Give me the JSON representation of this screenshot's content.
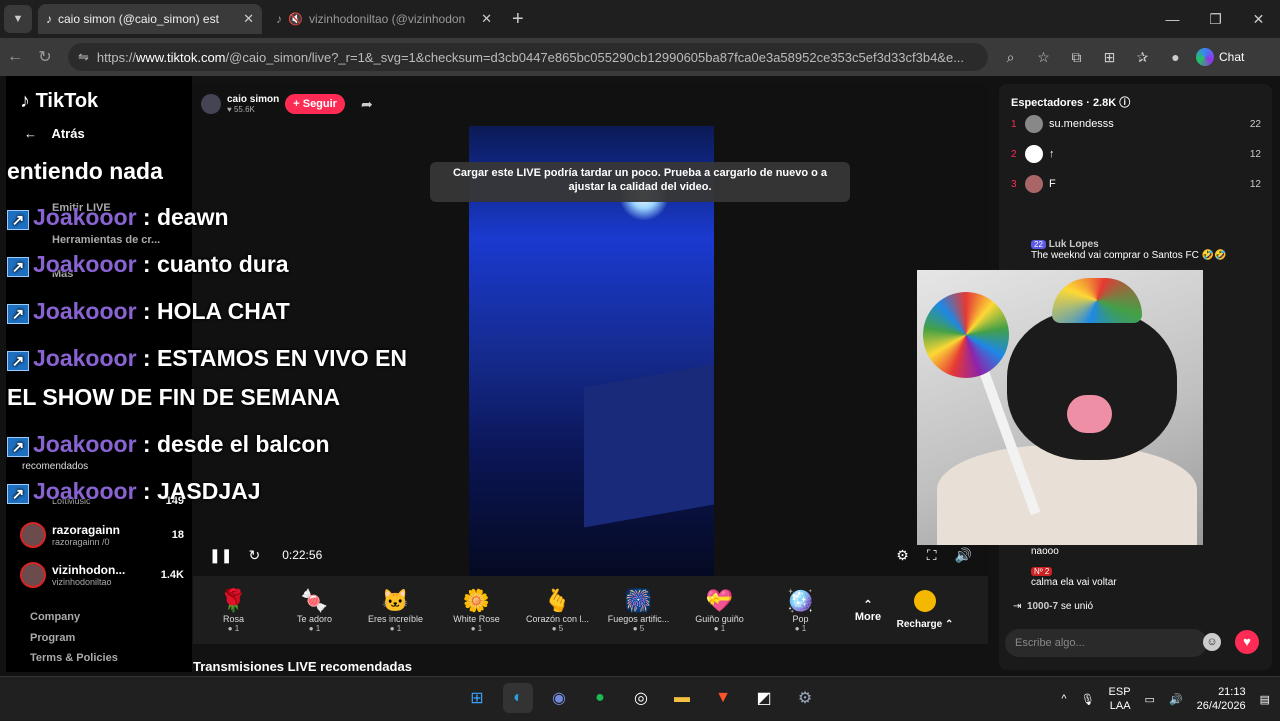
{
  "browser": {
    "tabs": [
      {
        "title": "caio simon (@caio_simon) est"
      },
      {
        "title": "vizinhodoniltao (@vizinhodon"
      }
    ],
    "url_prefix": "https://",
    "url_host": "www.tiktok.com",
    "url_rest": "/@caio_simon/live?_r=1&_svg=1&checksum=d3cb0447e865bc055290cb12990605ba87fca0e3a58952ce353c5ef3d33cf3b4&e...",
    "chat_label": "Chat"
  },
  "leftnav": {
    "logo": "TikTok",
    "back": "Atrás",
    "items": [
      "Emitir LIVE",
      "Herramientas de cr...",
      "Más"
    ],
    "recommended_heading": "recomendados",
    "recommended": [
      {
        "name": "razoragainn",
        "sub": "razoragainn /0",
        "count": "18"
      },
      {
        "name": "vizinhodon...",
        "sub": "vizinhodoniltao",
        "count": "1.4K"
      }
    ],
    "lofi_sub": "LoftMusic",
    "lofi_count": "149",
    "footer": [
      "Company",
      "Program",
      "Terms & Policies"
    ]
  },
  "stream": {
    "host_name": "caio simon",
    "host_followers": "55.6K",
    "follow_label": "+ Seguir",
    "loading_message": "Cargar este LIVE podría tardar un poco. Prueba a cargarlo de nuevo o a ajustar la calidad del video.",
    "elapsed": "0:22:56"
  },
  "gifts": [
    {
      "name": "Rosa",
      "cost": "1",
      "icon": "🌹"
    },
    {
      "name": "Te adoro",
      "cost": "1",
      "icon": "🍬"
    },
    {
      "name": "Eres increíble",
      "cost": "1",
      "icon": "🐱"
    },
    {
      "name": "White Rose",
      "cost": "1",
      "icon": "🌼"
    },
    {
      "name": "Corazón con l...",
      "cost": "5",
      "icon": "🫰"
    },
    {
      "name": "Fuegos artific...",
      "cost": "5",
      "icon": "🎆"
    },
    {
      "name": "Guiño guiño",
      "cost": "1",
      "icon": "💝"
    },
    {
      "name": "Pop",
      "cost": "1",
      "icon": "🪩"
    }
  ],
  "gift_more": "More",
  "gift_recharge": "Recharge",
  "recommended_live_heading": "Transmisiones LIVE recomendadas",
  "viewers": {
    "heading": "Espectadores",
    "count": "2.8K",
    "rows": [
      {
        "rank": "1",
        "name": "su.mendesss",
        "score": "22"
      },
      {
        "rank": "2",
        "name": "↑",
        "score": "12"
      },
      {
        "rank": "3",
        "name": "F",
        "score": "12"
      }
    ]
  },
  "chat": {
    "msg1_badge": "22",
    "msg1_user": "Luk Lopes",
    "msg1_text": "The weeknd vai comprar o Santos FC 🤣🤣",
    "msg2_text": "naooo",
    "msg3_badge": "Nº 2",
    "msg3_text": "calma ela vai voltar",
    "join_user": "1000-7",
    "join_text": "se unió",
    "input_placeholder": "Escribe algo..."
  },
  "overlay_chat": [
    {
      "user": "",
      "text": "entiendo nada"
    },
    {
      "user": "Joakooor",
      "text": " : deawn"
    },
    {
      "user": "Joakooor",
      "text": " : cuanto dura"
    },
    {
      "user": "Joakooor",
      "text": " : HOLA CHAT"
    },
    {
      "user": "Joakooor",
      "text": " : ESTAMOS EN VIVO EN"
    },
    {
      "user": "",
      "text": "EL SHOW DE FIN DE SEMANA"
    },
    {
      "user": "Joakooor",
      "text": " : desde el balcon"
    },
    {
      "user": "Joakooor",
      "text": " : JASDJAJ"
    }
  ],
  "taskbar": {
    "lang": "ESP",
    "layout": "LAA",
    "time": "21:13",
    "date": "26/4/2026"
  }
}
